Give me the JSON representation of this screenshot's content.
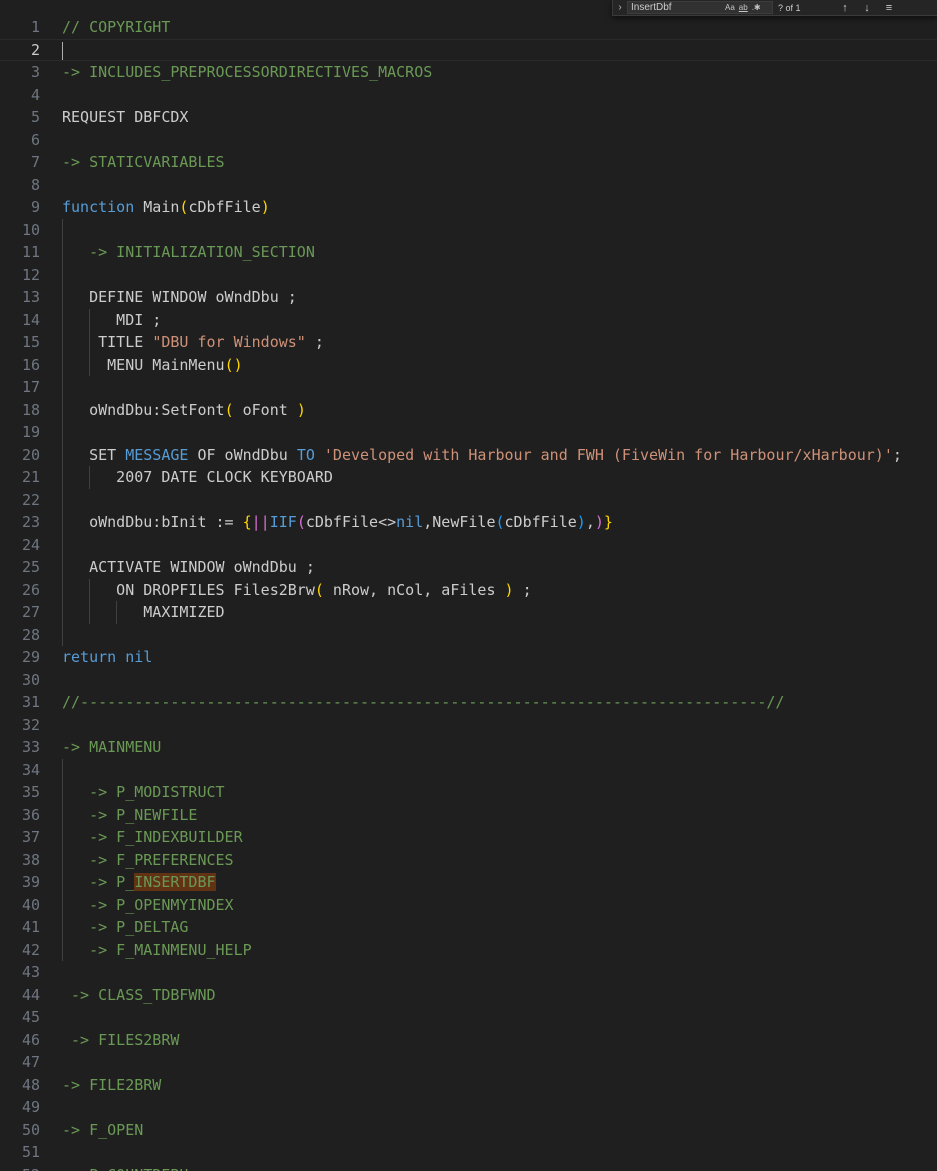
{
  "find_widget": {
    "toggle_icon": "chevron-right",
    "query": "InsertDbf",
    "match_case_label": "Aa",
    "whole_word_label": "ab",
    "regex_icon": "regex",
    "result_count": "? of 1",
    "prev_icon": "arrow-up",
    "next_icon": "arrow-down",
    "selection_icon": "hamburger"
  },
  "editor": {
    "active_line": 2,
    "colors": {
      "background": "#1f1f1f",
      "comment": "#6a9955",
      "keyword": "#569cd6",
      "string": "#ce9178",
      "bracket_gold": "#ffd700",
      "bracket_purple": "#da70d6",
      "bracket_blue": "#179fff",
      "find_match_highlight": "#613214"
    },
    "lines": [
      {
        "n": 1,
        "tokens": [
          [
            "comment",
            "// COPYRIGHT"
          ]
        ]
      },
      {
        "n": 2,
        "tokens": []
      },
      {
        "n": 3,
        "tokens": [
          [
            "comment",
            "-> INCLUDES_PREPROCESSORDIRECTIVES_MACROS"
          ]
        ]
      },
      {
        "n": 4,
        "tokens": []
      },
      {
        "n": 5,
        "tokens": [
          [
            "plain",
            "REQUEST DBFCDX"
          ]
        ]
      },
      {
        "n": 6,
        "tokens": []
      },
      {
        "n": 7,
        "tokens": [
          [
            "comment",
            "-> STATICVARIABLES"
          ]
        ]
      },
      {
        "n": 8,
        "tokens": []
      },
      {
        "n": 9,
        "tokens": [
          [
            "kw",
            "function"
          ],
          [
            "plain",
            " Main"
          ],
          [
            "br1",
            "("
          ],
          [
            "plain",
            "cDbfFile"
          ],
          [
            "br1",
            ")"
          ]
        ]
      },
      {
        "n": 10,
        "tokens": []
      },
      {
        "n": 11,
        "tokens": [
          [
            "plain",
            "   "
          ],
          [
            "comment",
            "-> INITIALIZATION_SECTION"
          ]
        ]
      },
      {
        "n": 12,
        "tokens": []
      },
      {
        "n": 13,
        "tokens": [
          [
            "plain",
            "   DEFINE WINDOW oWndDbu ;"
          ]
        ]
      },
      {
        "n": 14,
        "tokens": [
          [
            "plain",
            "      MDI ;"
          ]
        ]
      },
      {
        "n": 15,
        "tokens": [
          [
            "plain",
            "    TITLE "
          ],
          [
            "str",
            "\"DBU for Windows\""
          ],
          [
            "plain",
            " ;"
          ]
        ]
      },
      {
        "n": 16,
        "tokens": [
          [
            "plain",
            "     MENU MainMenu"
          ],
          [
            "br1",
            "()"
          ]
        ]
      },
      {
        "n": 17,
        "tokens": []
      },
      {
        "n": 18,
        "tokens": [
          [
            "plain",
            "   oWndDbu:SetFont"
          ],
          [
            "br1",
            "("
          ],
          [
            "plain",
            " oFont "
          ],
          [
            "br1",
            ")"
          ]
        ]
      },
      {
        "n": 19,
        "tokens": []
      },
      {
        "n": 20,
        "tokens": [
          [
            "plain",
            "   SET "
          ],
          [
            "kw",
            "MESSAGE"
          ],
          [
            "plain",
            " OF oWndDbu "
          ],
          [
            "kw",
            "TO"
          ],
          [
            "plain",
            " "
          ],
          [
            "str",
            "'Developed with Harbour and FWH (FiveWin for Harbour/xHarbour)'"
          ],
          [
            "plain",
            ";"
          ]
        ]
      },
      {
        "n": 21,
        "tokens": [
          [
            "plain",
            "      2007 DATE CLOCK KEYBOARD"
          ]
        ]
      },
      {
        "n": 22,
        "tokens": []
      },
      {
        "n": 23,
        "tokens": [
          [
            "plain",
            "   oWndDbu:bInit := "
          ],
          [
            "br1",
            "{"
          ],
          [
            "br2",
            "||"
          ],
          [
            "kw",
            "IIF"
          ],
          [
            "br2",
            "("
          ],
          [
            "plain",
            "cDbfFile<>"
          ],
          [
            "kw",
            "nil"
          ],
          [
            "plain",
            ",NewFile"
          ],
          [
            "br3",
            "("
          ],
          [
            "plain",
            "cDbfFile"
          ],
          [
            "br3",
            ")"
          ],
          [
            "plain",
            ","
          ],
          [
            "br2",
            ")"
          ],
          [
            "br1",
            "}"
          ]
        ]
      },
      {
        "n": 24,
        "tokens": []
      },
      {
        "n": 25,
        "tokens": [
          [
            "plain",
            "   ACTIVATE WINDOW oWndDbu ;"
          ]
        ]
      },
      {
        "n": 26,
        "tokens": [
          [
            "plain",
            "      ON DROPFILES Files2Brw"
          ],
          [
            "br1",
            "("
          ],
          [
            "plain",
            " nRow, nCol, aFiles "
          ],
          [
            "br1",
            ")"
          ],
          [
            "plain",
            " ;"
          ]
        ]
      },
      {
        "n": 27,
        "tokens": [
          [
            "plain",
            "         MAXIMIZED"
          ]
        ]
      },
      {
        "n": 28,
        "tokens": []
      },
      {
        "n": 29,
        "tokens": [
          [
            "kw",
            "return"
          ],
          [
            "plain",
            " "
          ],
          [
            "kw",
            "nil"
          ]
        ]
      },
      {
        "n": 30,
        "tokens": []
      },
      {
        "n": 31,
        "tokens": [
          [
            "comment",
            "//----------------------------------------------------------------------------//"
          ]
        ]
      },
      {
        "n": 32,
        "tokens": []
      },
      {
        "n": 33,
        "tokens": [
          [
            "comment",
            "-> MAINMENU"
          ]
        ]
      },
      {
        "n": 34,
        "tokens": []
      },
      {
        "n": 35,
        "tokens": [
          [
            "plain",
            "   "
          ],
          [
            "comment",
            "-> P_MODISTRUCT"
          ]
        ]
      },
      {
        "n": 36,
        "tokens": [
          [
            "plain",
            "   "
          ],
          [
            "comment",
            "-> P_NEWFILE"
          ]
        ]
      },
      {
        "n": 37,
        "tokens": [
          [
            "plain",
            "   "
          ],
          [
            "comment",
            "-> F_INDEXBUILDER"
          ]
        ]
      },
      {
        "n": 38,
        "tokens": [
          [
            "plain",
            "   "
          ],
          [
            "comment",
            "-> F_PREFERENCES"
          ]
        ]
      },
      {
        "n": 39,
        "tokens": [
          [
            "plain",
            "   "
          ],
          [
            "comment",
            "-> P_"
          ],
          [
            "match",
            "INSERTDBF"
          ]
        ]
      },
      {
        "n": 40,
        "tokens": [
          [
            "plain",
            "   "
          ],
          [
            "comment",
            "-> P_OPENMYINDEX"
          ]
        ]
      },
      {
        "n": 41,
        "tokens": [
          [
            "plain",
            "   "
          ],
          [
            "comment",
            "-> P_DELTAG"
          ]
        ]
      },
      {
        "n": 42,
        "tokens": [
          [
            "plain",
            "   "
          ],
          [
            "comment",
            "-> F_MAINMENU_HELP"
          ]
        ]
      },
      {
        "n": 43,
        "tokens": []
      },
      {
        "n": 44,
        "tokens": [
          [
            "plain",
            " "
          ],
          [
            "comment",
            "-> CLASS_TDBFWND"
          ]
        ]
      },
      {
        "n": 45,
        "tokens": []
      },
      {
        "n": 46,
        "tokens": [
          [
            "plain",
            " "
          ],
          [
            "comment",
            "-> FILES2BRW"
          ]
        ]
      },
      {
        "n": 47,
        "tokens": []
      },
      {
        "n": 48,
        "tokens": [
          [
            "comment",
            "-> FILE2BRW"
          ]
        ]
      },
      {
        "n": 49,
        "tokens": []
      },
      {
        "n": 50,
        "tokens": [
          [
            "comment",
            "-> F_OPEN"
          ]
        ]
      },
      {
        "n": 51,
        "tokens": []
      },
      {
        "n": 52,
        "tokens": [
          [
            "comment",
            "-> P_COUNTREBU"
          ]
        ]
      }
    ]
  }
}
